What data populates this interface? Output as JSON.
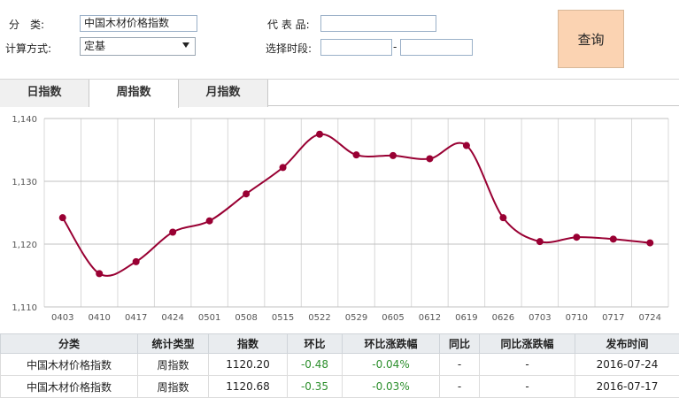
{
  "form": {
    "category_label": "分　类:",
    "category_value": "中国木材价格指数",
    "calc_label": "计算方式:",
    "calc_value": "定基",
    "product_label": "代 表 品:",
    "product_value": "",
    "period_label": "选择时段:",
    "period_start": "",
    "period_sep": "-",
    "period_end": "",
    "query_button": "查询"
  },
  "tabs": [
    {
      "label": "日指数",
      "active": false
    },
    {
      "label": "周指数",
      "active": true
    },
    {
      "label": "月指数",
      "active": false
    }
  ],
  "chart_data": {
    "type": "line",
    "categories": [
      "0403",
      "0410",
      "0417",
      "0424",
      "0501",
      "0508",
      "0515",
      "0522",
      "0529",
      "0605",
      "0612",
      "0619",
      "0626",
      "0703",
      "0710",
      "0717",
      "0724"
    ],
    "values": [
      1124.2,
      1115.3,
      1117.2,
      1121.9,
      1123.7,
      1128.0,
      1132.2,
      1137.5,
      1134.2,
      1134.1,
      1133.6,
      1135.7,
      1124.2,
      1120.4,
      1121.1,
      1120.8,
      1120.2
    ],
    "y_ticks": [
      "1,110",
      "1,120",
      "1,130",
      "1,140"
    ],
    "ylim": [
      1110,
      1140
    ],
    "grid": true,
    "line_color": "#990033",
    "marker_color": "#990033"
  },
  "table": {
    "headers": [
      "分类",
      "统计类型",
      "指数",
      "环比",
      "环比涨跌幅",
      "同比",
      "同比涨跌幅",
      "发布时间"
    ],
    "rows": [
      [
        "中国木材价格指数",
        "周指数",
        "1120.20",
        "-0.48",
        "-0.04%",
        "-",
        "-",
        "2016-07-24"
      ],
      [
        "中国木材价格指数",
        "周指数",
        "1120.68",
        "-0.35",
        "-0.03%",
        "-",
        "-",
        "2016-07-17"
      ]
    ],
    "change_color": "#2d8f2d"
  }
}
